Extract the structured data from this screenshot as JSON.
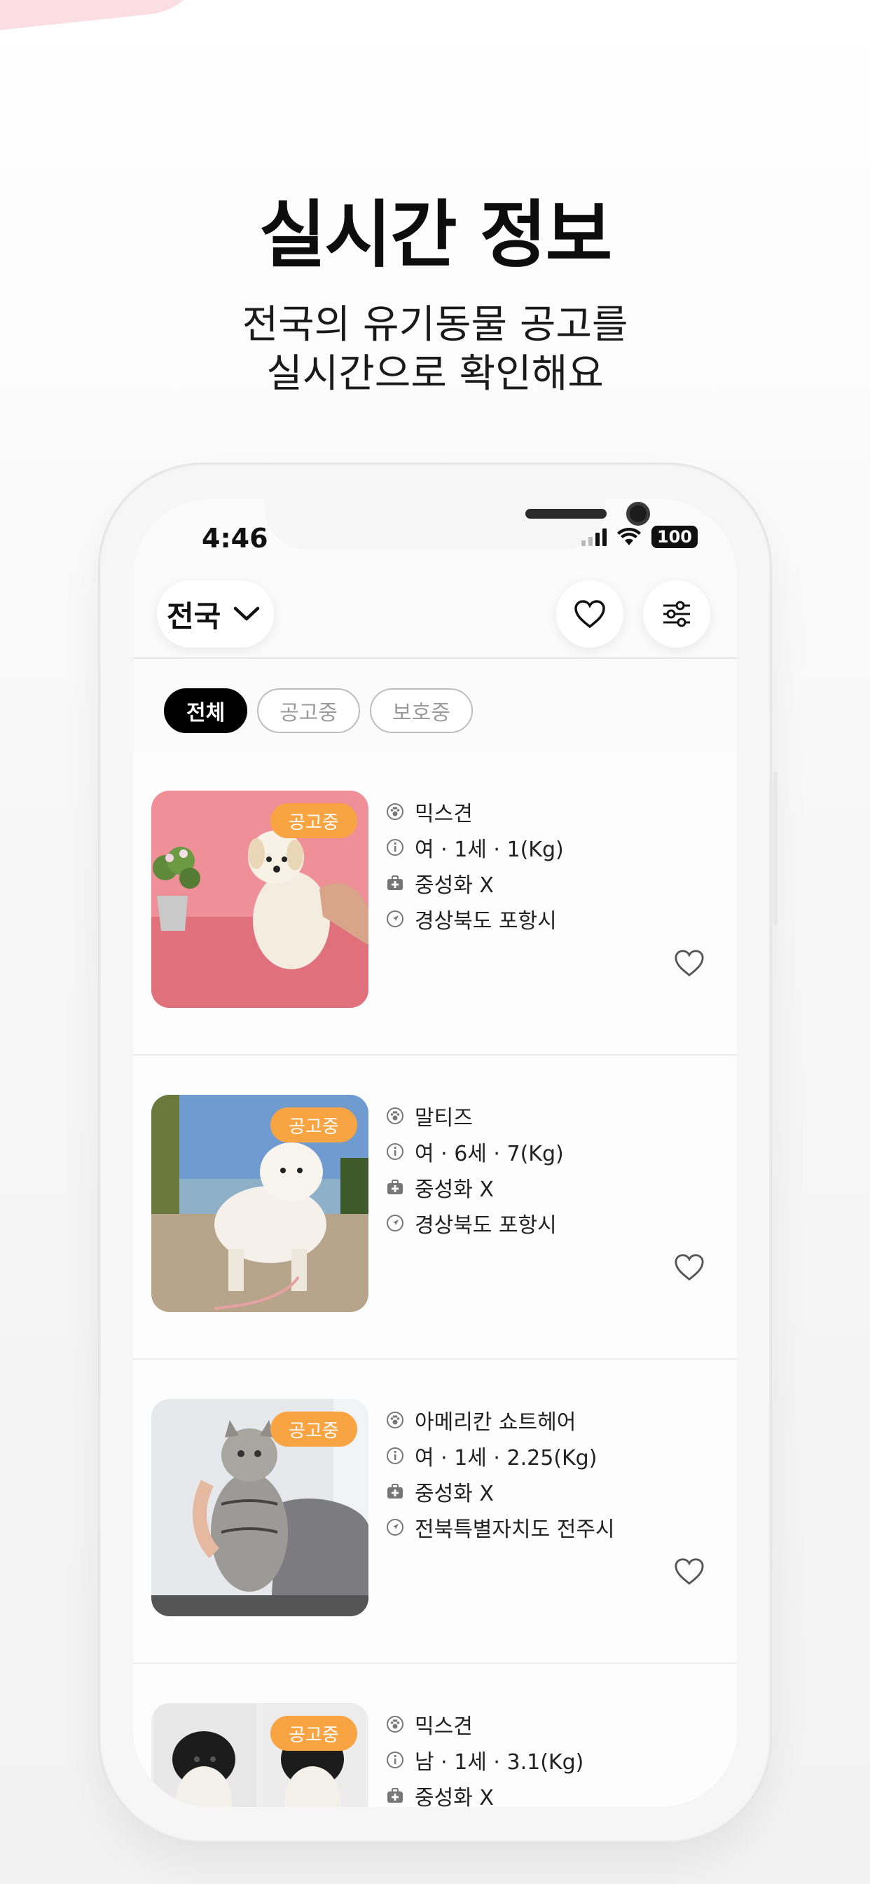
{
  "hero": {
    "title": "실시간 정보",
    "subtitle_line1": "전국의 유기동물 공고를",
    "subtitle_line2": "실시간으로 확인해요"
  },
  "status_bar": {
    "time": "4:46",
    "battery": "100"
  },
  "topbar": {
    "region": "전국"
  },
  "filters": [
    {
      "label": "전체",
      "active": true
    },
    {
      "label": "공고중",
      "active": false
    },
    {
      "label": "보호중",
      "active": false
    }
  ],
  "cards": [
    {
      "badge": "공고중",
      "breed": "믹스견",
      "details": "여 · 1세 · 1(Kg)",
      "neutered": "중성화 X",
      "location": "경상북도 포항시"
    },
    {
      "badge": "공고중",
      "breed": "말티즈",
      "details": "여 · 6세 · 7(Kg)",
      "neutered": "중성화 X",
      "location": "경상북도 포항시"
    },
    {
      "badge": "공고중",
      "breed": "아메리칸 쇼트헤어",
      "details": "여 · 1세 · 2.25(Kg)",
      "neutered": "중성화 X",
      "location": "전북특별자치도 전주시"
    },
    {
      "badge": "공고중",
      "breed": "믹스견",
      "details": "남 · 1세 · 3.1(Kg)",
      "neutered": "중성화 X",
      "location": ""
    }
  ],
  "colors": {
    "badge": "#f8a443",
    "active_chip": "#000000",
    "text": "#111111"
  }
}
